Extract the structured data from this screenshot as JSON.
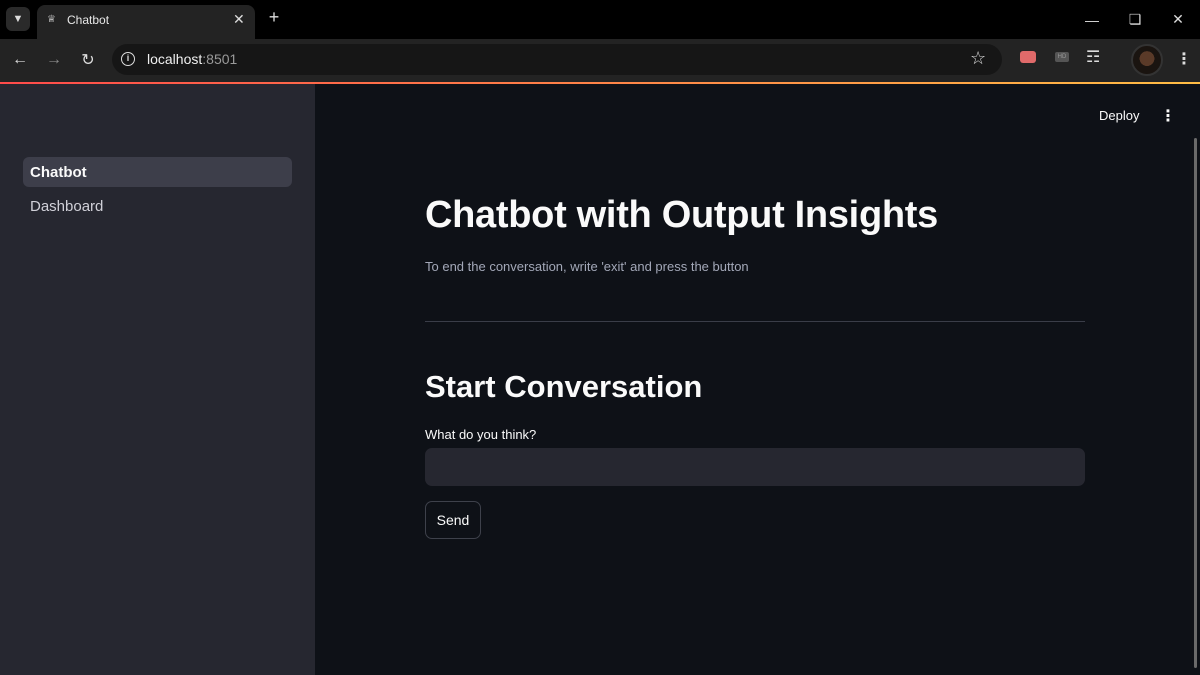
{
  "browser": {
    "tab": {
      "title": "Chatbot",
      "favicon": "streamlit-crown-icon"
    },
    "address": {
      "host": "localhost",
      "port": ":8501"
    },
    "icons": [
      "back-icon",
      "forward-icon",
      "reload-icon",
      "info-icon",
      "star-icon",
      "puzzle-icon",
      "menu-icon"
    ]
  },
  "sidebar": {
    "items": [
      {
        "label": "Chatbot",
        "active": true
      },
      {
        "label": "Dashboard",
        "active": false
      }
    ]
  },
  "header": {
    "deploy_label": "Deploy"
  },
  "main": {
    "title": "Chatbot with Output Insights",
    "caption": "To end the conversation, write 'exit' and press the button",
    "section_title": "Start Conversation",
    "input_label": "What do you think?",
    "input_value": "",
    "send_label": "Send"
  },
  "colors": {
    "app_bg": "#0e1117",
    "sidebar_bg": "#262730",
    "accent_start": "#ff4b4b",
    "accent_end": "#ffbd45"
  }
}
